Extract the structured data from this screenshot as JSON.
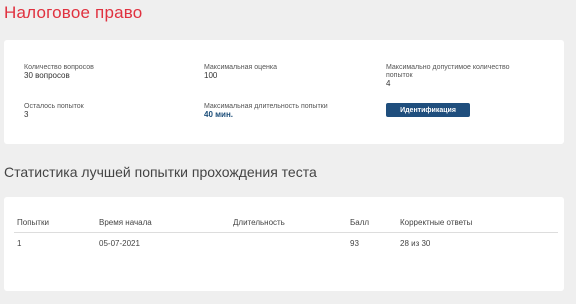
{
  "page": {
    "title": "Налоговое право"
  },
  "info": {
    "questions_label": "Количество вопросов",
    "questions_value": "30 вопросов",
    "max_score_label": "Максимальная оценка",
    "max_score_value": "100",
    "max_attempts_label": "Максимально допустимое количество попыток",
    "max_attempts_value": "4",
    "remaining_label": "Осталось попыток",
    "remaining_value": "3",
    "duration_label": "Максимальная длительность попытки",
    "duration_value": "40 мин.",
    "identify_button": "Идентификация"
  },
  "stats": {
    "title": "Статистика лучшей попытки прохождения теста",
    "columns": [
      "Попытки",
      "Время начала",
      "Длительность",
      "Балл",
      "Корректные ответы"
    ],
    "rows": [
      [
        "1",
        "05-07-2021",
        "",
        "93",
        "28 из 30"
      ]
    ]
  }
}
